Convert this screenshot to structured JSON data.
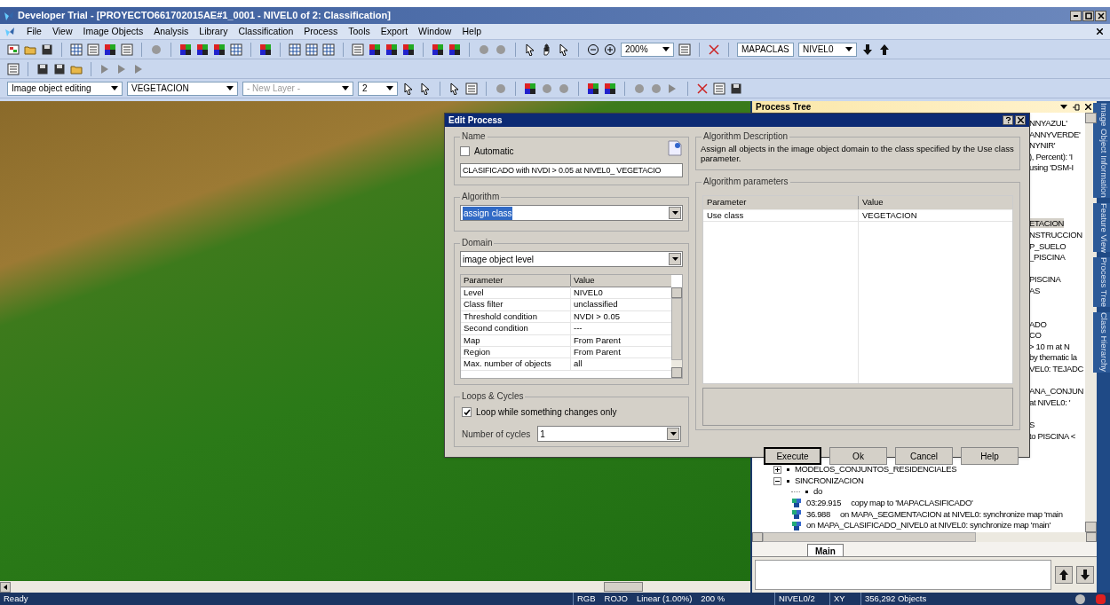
{
  "window": {
    "title": "Developer Trial - [PROYECTO661702015AE#1_0001 - NIVEL0 of 2: Classification]"
  },
  "menu": [
    "File",
    "View",
    "Image Objects",
    "Analysis",
    "Library",
    "Classification",
    "Process",
    "Tools",
    "Export",
    "Window",
    "Help"
  ],
  "toolbar": {
    "zoom": "200%",
    "map": "MAPACLAS",
    "level": "NIVEL0"
  },
  "edit_toolbar": {
    "mode": "Image object editing",
    "class": "VEGETACION",
    "layer": "- New Layer -",
    "layer_disabled": true,
    "size": "2"
  },
  "process_tree": {
    "title": "Process Tree",
    "fragment_groups": [
      [
        {
          "text": "NNYAZUL'",
          "selected": false
        },
        {
          "text": "ANNYVERDE'",
          "selected": false
        },
        {
          "text": "NYNIR'",
          "selected": false
        },
        {
          "text": "), Percent): 'I",
          "selected": false
        },
        {
          "text": "using 'DSM-I",
          "selected": false
        }
      ],
      [
        {
          "text": "ETACION",
          "selected": true
        },
        {
          "text": "NSTRUCCION",
          "selected": false
        },
        {
          "text": "P_SUELO",
          "selected": false
        },
        {
          "text": "_PISCINA",
          "selected": false
        }
      ],
      [
        {
          "text": "PISCINA",
          "selected": false
        },
        {
          "text": "AS",
          "selected": false
        }
      ],
      [
        {
          "text": "ADO",
          "selected": false
        },
        {
          "text": "CO",
          "selected": false
        },
        {
          "text": "> 10 m at  N",
          "selected": false
        },
        {
          "text": "by thematic la",
          "selected": false
        },
        {
          "text": "VEL0: TEJADC",
          "selected": false
        }
      ],
      [
        {
          "text": "ANA_CONJUN",
          "selected": false
        },
        {
          "text": "at  NIVEL0: '",
          "selected": false
        }
      ],
      [
        {
          "text": "S",
          "selected": false
        },
        {
          "text": "to PISCINA <",
          "selected": false
        }
      ]
    ],
    "tree": [
      {
        "label": "MODELOS_CONJUNTOS_RESIDENCIALES",
        "expanded": false
      },
      {
        "label": "SINCRONIZACION",
        "expanded": true,
        "children": [
          {
            "kind": "bullet",
            "label": "do"
          },
          {
            "kind": "process",
            "time": "03:29.915",
            "label": "copy map to 'MAPACLASIFICADO'"
          },
          {
            "kind": "process",
            "time": "36.988",
            "label": "on MAPA_SEGMENTACION at  NIVEL0: synchronize map 'main"
          },
          {
            "kind": "process",
            "label": "on MAPA_CLASIFICADO_NIVEL0 at  NIVEL0: synchronize map 'main'"
          }
        ]
      }
    ],
    "tabs": [
      {
        "label": "Main",
        "selected": true
      }
    ]
  },
  "side_tabs": [
    "Image Object Information",
    "Feature View",
    "Process Tree",
    "Class Hierarchy"
  ],
  "dialog": {
    "title": "Edit Process",
    "name": {
      "legend": "Name",
      "automatic_label": "Automatic",
      "automatic": false,
      "value": "CLASIFICADO with NVDI > 0.05  at  NIVEL0_ VEGETACIO"
    },
    "algorithm": {
      "legend": "Algorithm",
      "value": "assign class"
    },
    "domain": {
      "legend": "Domain",
      "value": "image object level",
      "columns": [
        "Parameter",
        "Value"
      ],
      "rows": [
        [
          "Level",
          "NIVEL0"
        ],
        [
          "Class filter",
          "unclassified"
        ],
        [
          "Threshold condition",
          "NVDI > 0.05"
        ],
        [
          "Second condition",
          "---"
        ],
        [
          "Map",
          "From Parent"
        ],
        [
          "Region",
          "From Parent"
        ],
        [
          "Max. number of objects",
          "all"
        ]
      ]
    },
    "loops": {
      "legend": "Loops & Cycles",
      "loop_label": "Loop while something changes only",
      "loop": true,
      "cycles_label": "Number of cycles",
      "cycles": "1"
    },
    "description": {
      "legend": "Algorithm Description",
      "text": "Assign all objects in the image object domain to the class specified by the Use class parameter."
    },
    "parameters": {
      "legend": "Algorithm parameters",
      "columns": [
        "Parameter",
        "Value"
      ],
      "rows": [
        [
          "Use class",
          "VEGETACION"
        ]
      ]
    },
    "buttons": [
      {
        "label": "Execute",
        "default": true
      },
      {
        "label": "Ok",
        "default": false
      },
      {
        "label": "Cancel",
        "default": false
      },
      {
        "label": "Help",
        "default": false
      }
    ]
  },
  "status_bar": {
    "message": "Ready",
    "mode": "RGB",
    "layer": "ROJO",
    "stretch": "Linear (1.00%)",
    "zoom": "200 %",
    "level": "NIVEL0/2",
    "coords": "XY",
    "objects": "356,292 Objects"
  }
}
